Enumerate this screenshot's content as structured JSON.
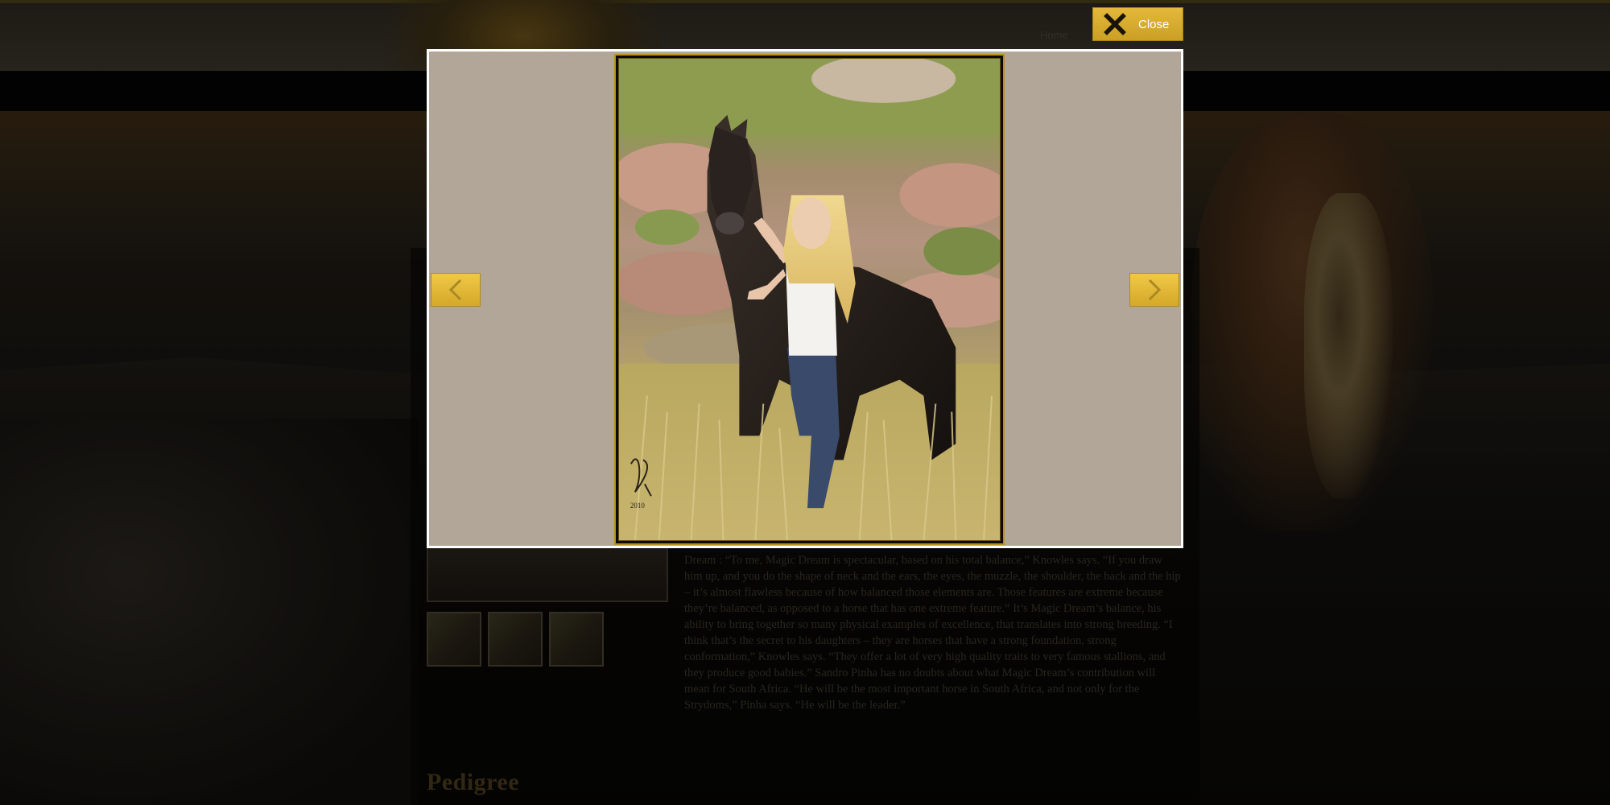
{
  "background_page": {
    "nav": {
      "home_label": "Home"
    },
    "article_text": "Dream : “To me, Magic Dream is spectacular, based on his total balance,” Knowles says. “If you draw him up, and you do the shape of neck and the ears, the eyes, the muzzle, the shoulder, the back and the hip – it’s almost flawless because of how balanced those elements are. Those features are extreme because they’re balanced, as opposed to a horse that has one extreme feature.” It’s Magic Dream’s balance, his ability to bring together so many physical examples of excellence, that translates into strong breeding. “I think that’s the secret to his daughters – they are horses that have a strong foundation, strong conformation,” Knowles says. “They offer a lot of very high quality traits to very famous stallions, and they produce good babies.” Sandro Pinha has no doubts about what Magic Dream’s contribution will mean for South Africa. “He will be the most important horse in South Africa, and not only for the Strydoms,” Pinha says. “He will be the leader.”",
    "section_heading": "Pedigree",
    "thumbnail_count": 3
  },
  "lightbox": {
    "close_label": "Close",
    "close_icon": "close-icon",
    "prev_icon": "chevron-left-icon",
    "next_icon": "chevron-right-icon",
    "photo_signature": "2010"
  },
  "colors": {
    "button_gold": "#e4b83a",
    "stage_background": "#b1a697",
    "frame_gold": "#b8901c"
  }
}
